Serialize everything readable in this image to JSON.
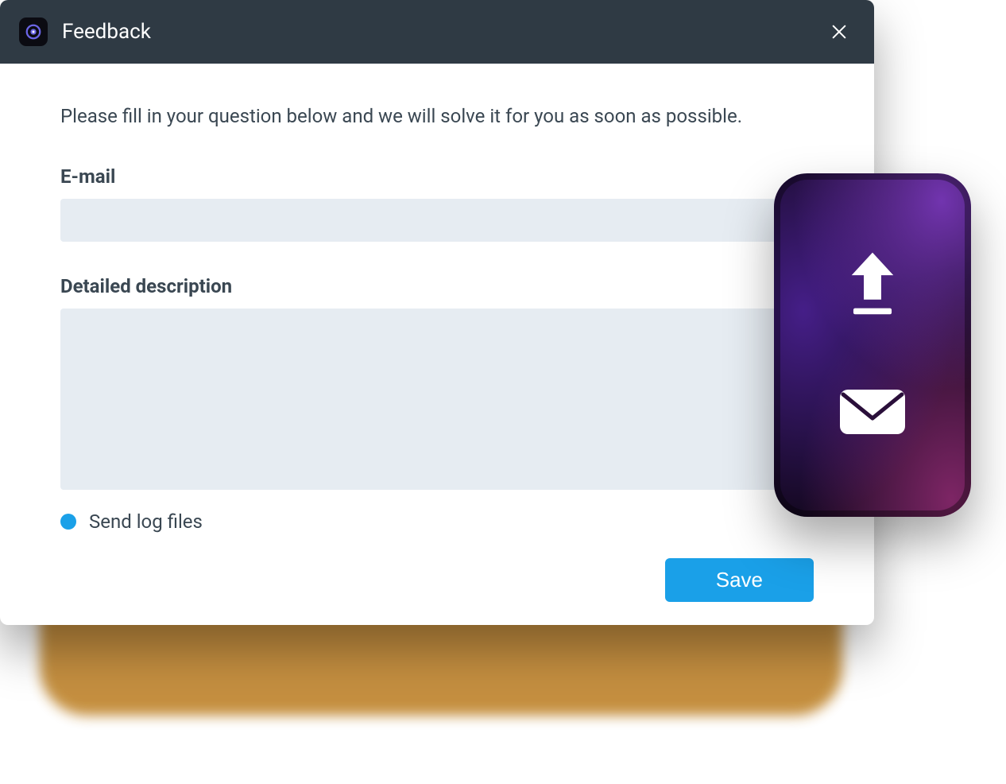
{
  "titlebar": {
    "title": "Feedback",
    "app_icon": "app-target-icon",
    "close_icon": "close-icon"
  },
  "form": {
    "intro": "Please fill in your question below and we will solve it for you as soon as possible.",
    "email_label": "E-mail",
    "email_value": "",
    "desc_label": "Detailed description",
    "desc_value": "",
    "logs_label": "Send log files",
    "logs_checked": true,
    "save_label": "Save"
  },
  "sidecard": {
    "upload_icon": "upload-icon",
    "mail_icon": "mail-icon"
  }
}
